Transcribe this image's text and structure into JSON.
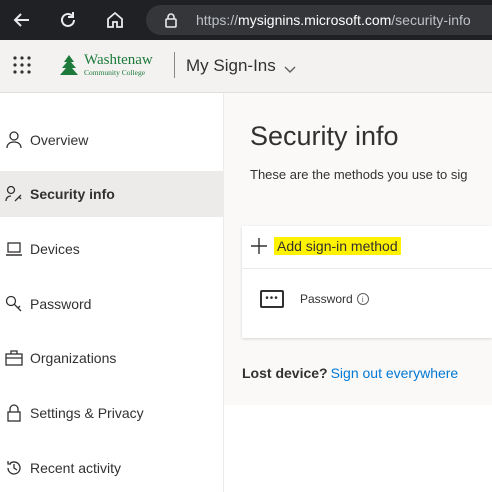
{
  "browser": {
    "url_prefix": "https://",
    "url_domain": "mysignins.microsoft.com",
    "url_path": "/security-info"
  },
  "header": {
    "logo_name": "Washtenaw",
    "logo_sub": "Community College",
    "app_title": "My Sign-Ins"
  },
  "sidebar": {
    "items": [
      {
        "label": "Overview",
        "icon": "person-icon"
      },
      {
        "label": "Security info",
        "icon": "person-key-icon",
        "active": true
      },
      {
        "label": "Devices",
        "icon": "laptop-icon"
      },
      {
        "label": "Password",
        "icon": "key-icon"
      },
      {
        "label": "Organizations",
        "icon": "briefcase-icon"
      },
      {
        "label": "Settings & Privacy",
        "icon": "lock-icon"
      },
      {
        "label": "Recent activity",
        "icon": "history-icon"
      }
    ]
  },
  "main": {
    "title": "Security info",
    "subtitle": "These are the methods you use to sig",
    "add_method_label": "Add sign-in method",
    "methods": [
      {
        "icon_text": "•••",
        "name": "Password"
      }
    ],
    "lost_device_label": "Lost device?",
    "lost_device_link": "Sign out everywhere"
  },
  "colors": {
    "accent": "#0078d4",
    "highlight": "#fff200",
    "brand": "#1e7a3b",
    "browser_bg": "#202124"
  }
}
